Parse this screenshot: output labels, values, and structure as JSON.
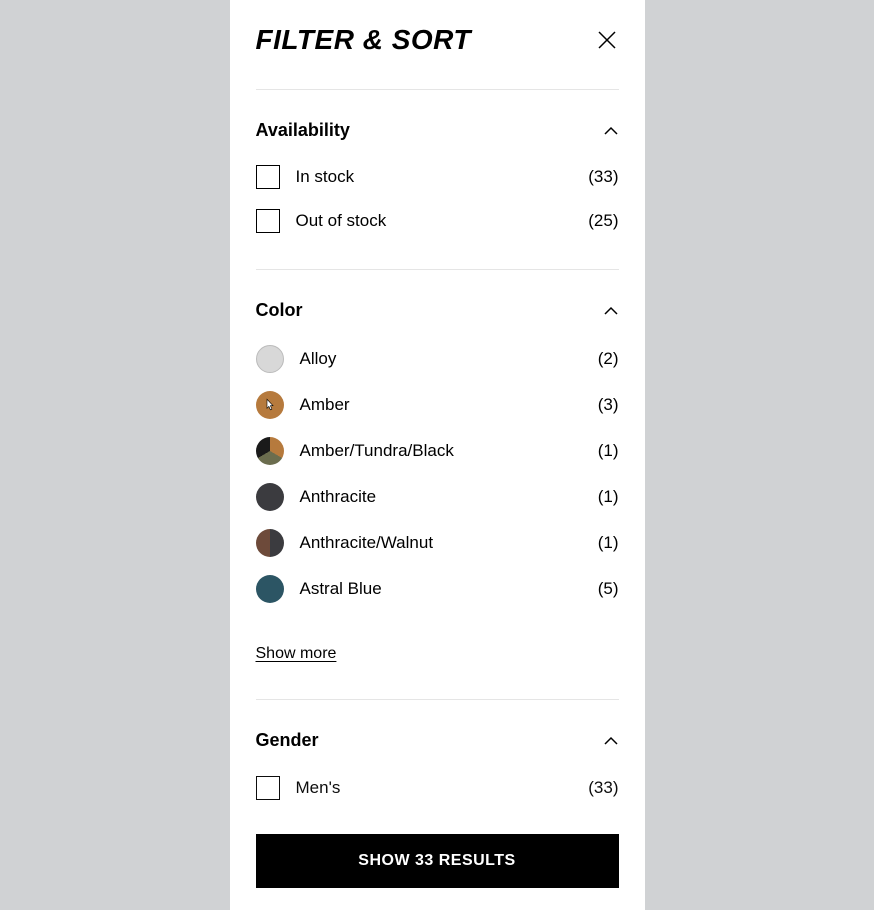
{
  "header": {
    "title": "FILTER & SORT"
  },
  "sections": {
    "availability": {
      "title": "Availability",
      "options": [
        {
          "label": "In stock",
          "count": "(33)"
        },
        {
          "label": "Out of stock",
          "count": "(25)"
        }
      ]
    },
    "color": {
      "title": "Color",
      "options": [
        {
          "label": "Alloy",
          "count": "(2)"
        },
        {
          "label": "Amber",
          "count": "(3)"
        },
        {
          "label": "Amber/Tundra/Black",
          "count": "(1)"
        },
        {
          "label": "Anthracite",
          "count": "(1)"
        },
        {
          "label": "Anthracite/Walnut",
          "count": "(1)"
        },
        {
          "label": "Astral Blue",
          "count": "(5)"
        }
      ],
      "show_more": "Show more"
    },
    "gender": {
      "title": "Gender",
      "options": [
        {
          "label": "Men's",
          "count": "(33)"
        }
      ]
    }
  },
  "footer": {
    "button_label": "SHOW 33 RESULTS"
  }
}
